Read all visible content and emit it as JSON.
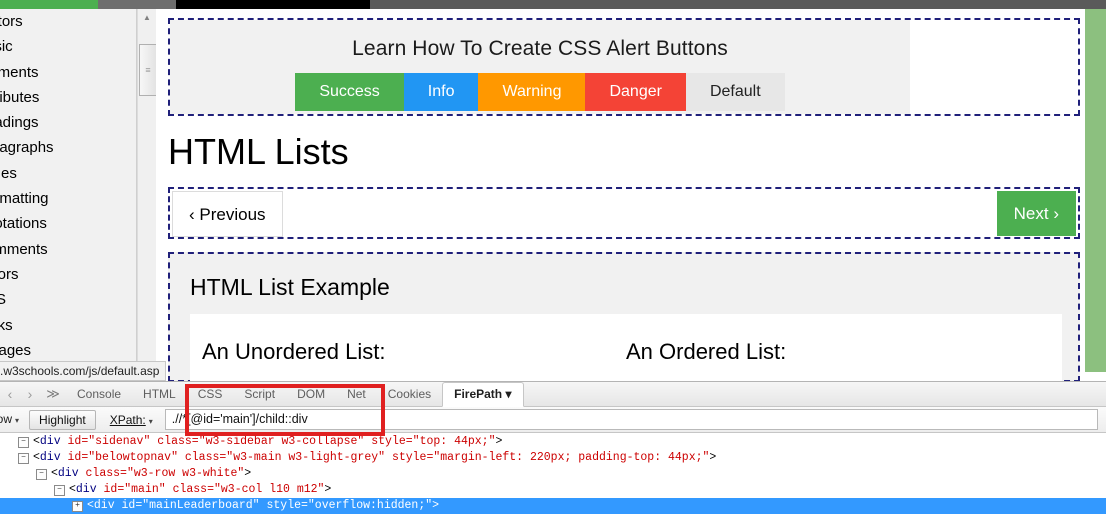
{
  "window_chrome": {
    "top_strip_segments": [
      "#4CAF50",
      "#6e6e6e",
      "#000000",
      "#5a5a5a"
    ]
  },
  "sidebar": {
    "items": [
      {
        "label": "ditors"
      },
      {
        "label": "asic"
      },
      {
        "label": "lements"
      },
      {
        "label": "ttributes"
      },
      {
        "label": "eadings"
      },
      {
        "label": "aragraphs"
      },
      {
        "label": "tyles"
      },
      {
        "label": "ormatting"
      },
      {
        "label": "uotations"
      },
      {
        "label": "omments"
      },
      {
        "label": "olors"
      },
      {
        "label": "SS"
      },
      {
        "label": "inks"
      },
      {
        "label": "mages"
      }
    ]
  },
  "scrollbar": {
    "up_arrow_glyph": "▲",
    "thumb_grip_glyph": "≡"
  },
  "ad": {
    "title": "Learn How To Create CSS Alert Buttons",
    "buttons": [
      {
        "label": "Success",
        "color": "#4CAF50"
      },
      {
        "label": "Info",
        "color": "#2196F3"
      },
      {
        "label": "Warning",
        "color": "#FF9800"
      },
      {
        "label": "Danger",
        "color": "#F44336"
      },
      {
        "label": "Default",
        "color": "#E7E7E7"
      }
    ]
  },
  "page": {
    "title": "HTML Lists",
    "previous_label": "‹ Previous",
    "next_label": "Next ›",
    "next_color": "#4CAF50"
  },
  "example": {
    "title": "HTML List Example",
    "unordered_heading": "An Unordered List:",
    "ordered_heading": "An Ordered List:"
  },
  "status_bar": {
    "url": ".w3schools.com/js/default.asp"
  },
  "firebug": {
    "nav_back_glyph": "‹",
    "nav_forward_glyph": "›",
    "menu_glyph": "≫",
    "tabs": [
      {
        "label": "Console",
        "active": false
      },
      {
        "label": "HTML",
        "active": false
      },
      {
        "label": "CSS",
        "active": false
      },
      {
        "label": "Script",
        "active": false
      },
      {
        "label": "DOM",
        "active": false
      },
      {
        "label": "Net",
        "active": false
      },
      {
        "label": "Cookies",
        "active": false
      },
      {
        "label": "FirePath ▾",
        "active": true
      }
    ],
    "toolbar": {
      "window_label": "dow",
      "window_caret": "▾",
      "highlight_label": "Highlight",
      "xpath_label": "XPath:",
      "xpath_caret": "▾",
      "xpath_value": ".//*[@id='main']/child::div"
    },
    "source_lines": [
      {
        "indent": 1,
        "twisty": "−",
        "selected": false,
        "segments": [
          {
            "t": "punc",
            "v": "<"
          },
          {
            "t": "tagname",
            "v": "div"
          },
          {
            "t": "punc",
            "v": " "
          },
          {
            "t": "attrname",
            "v": "id="
          },
          {
            "t": "attrval",
            "v": "\"sidenav\""
          },
          {
            "t": "punc",
            "v": " "
          },
          {
            "t": "attrname",
            "v": "class="
          },
          {
            "t": "attrval",
            "v": "\"w3-sidebar w3-collapse\""
          },
          {
            "t": "punc",
            "v": " "
          },
          {
            "t": "attrname",
            "v": "style="
          },
          {
            "t": "attrval",
            "v": "\"top: 44px;\""
          },
          {
            "t": "punc",
            "v": ">"
          }
        ]
      },
      {
        "indent": 1,
        "twisty": "−",
        "selected": false,
        "segments": [
          {
            "t": "punc",
            "v": "<"
          },
          {
            "t": "tagname",
            "v": "div"
          },
          {
            "t": "punc",
            "v": " "
          },
          {
            "t": "attrname",
            "v": "id="
          },
          {
            "t": "attrval",
            "v": "\"belowtopnav\""
          },
          {
            "t": "punc",
            "v": " "
          },
          {
            "t": "attrname",
            "v": "class="
          },
          {
            "t": "attrval",
            "v": "\"w3-main w3-light-grey\""
          },
          {
            "t": "punc",
            "v": " "
          },
          {
            "t": "attrname",
            "v": "style="
          },
          {
            "t": "attrval",
            "v": "\"margin-left: 220px; padding-top: 44px;\""
          },
          {
            "t": "punc",
            "v": ">"
          }
        ]
      },
      {
        "indent": 2,
        "twisty": "−",
        "selected": false,
        "segments": [
          {
            "t": "punc",
            "v": "<"
          },
          {
            "t": "tagname",
            "v": "div"
          },
          {
            "t": "punc",
            "v": " "
          },
          {
            "t": "attrname",
            "v": "class="
          },
          {
            "t": "attrval",
            "v": "\"w3-row w3-white\""
          },
          {
            "t": "punc",
            "v": ">"
          }
        ]
      },
      {
        "indent": 3,
        "twisty": "−",
        "selected": false,
        "segments": [
          {
            "t": "punc",
            "v": "<"
          },
          {
            "t": "tagname",
            "v": "div"
          },
          {
            "t": "punc",
            "v": " "
          },
          {
            "t": "attrname",
            "v": "id="
          },
          {
            "t": "attrval",
            "v": "\"main\""
          },
          {
            "t": "punc",
            "v": " "
          },
          {
            "t": "attrname",
            "v": "class="
          },
          {
            "t": "attrval",
            "v": "\"w3-col l10 m12\""
          },
          {
            "t": "punc",
            "v": ">"
          }
        ]
      },
      {
        "indent": 4,
        "twisty": "+",
        "selected": true,
        "segments": [
          {
            "t": "punc",
            "v": "<"
          },
          {
            "t": "tagname",
            "v": "div"
          },
          {
            "t": "punc",
            "v": " "
          },
          {
            "t": "attrname",
            "v": "id="
          },
          {
            "t": "attrval",
            "v": "\"mainLeaderboard\""
          },
          {
            "t": "punc",
            "v": " "
          },
          {
            "t": "attrname",
            "v": "style="
          },
          {
            "t": "attrval",
            "v": "\"overflow:hidden;\""
          },
          {
            "t": "punc",
            "v": ">"
          }
        ]
      }
    ]
  },
  "annotation": {
    "highlight_color": "#e02020"
  }
}
